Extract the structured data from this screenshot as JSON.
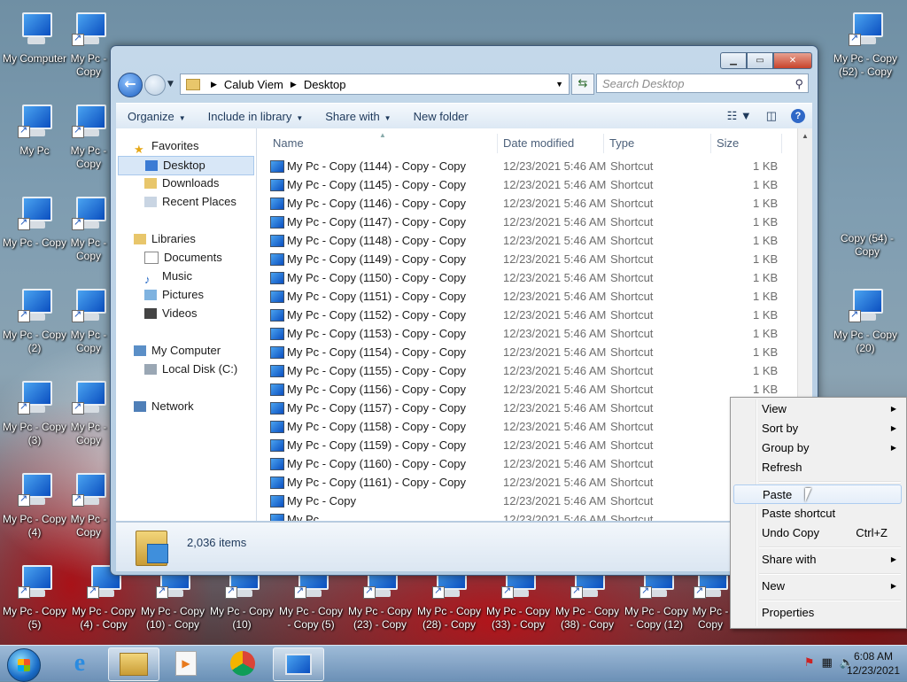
{
  "desktop": {
    "icons": [
      {
        "label": "My Computer"
      },
      {
        "label": "My Pc - Copy (6)"
      },
      {
        "label": "My Pc"
      },
      {
        "label": "My Pc - Copy (5) - C"
      },
      {
        "label": "My Pc - Copy"
      },
      {
        "label": "My Pc - Copy (7)"
      },
      {
        "label": "My Pc - Copy (2)"
      },
      {
        "label": "My Pc - Copy"
      },
      {
        "label": "My Pc - Copy (3)"
      },
      {
        "label": "My Pc - Copy (2) - C"
      },
      {
        "label": "My Pc - Copy (4)"
      },
      {
        "label": "My Pc - Copy (3) - C"
      },
      {
        "label": "My Pc - Copy (5)"
      },
      {
        "label": "My Pc - Copy (4) - Copy"
      },
      {
        "label": "My Pc - Copy (10) - Copy"
      },
      {
        "label": "My Pc - Copy (10)"
      },
      {
        "label": "My Pc - Copy - Copy (5)"
      },
      {
        "label": "My Pc - Copy (23) - Copy"
      },
      {
        "label": "My Pc - Copy (28) - Copy"
      },
      {
        "label": "My Pc - Copy (33) - Copy"
      },
      {
        "label": "My Pc - Copy (38) - Copy"
      },
      {
        "label": "My Pc - Copy - Copy (12)"
      },
      {
        "label": "My Pc - Copy (44) - Copy"
      },
      {
        "label": "My Pc - Copy (52) - Copy"
      },
      {
        "label": "Copy (54) - Copy"
      },
      {
        "label": "My Pc - Copy (20)"
      }
    ]
  },
  "explorer": {
    "address": {
      "segments": [
        "Calub Viem",
        "Desktop"
      ]
    },
    "search": {
      "placeholder": "Search Desktop"
    },
    "toolbar": {
      "organize": "Organize",
      "include": "Include in library",
      "share": "Share with",
      "new_folder": "New folder"
    },
    "nav": {
      "favorites": "Favorites",
      "desktop": "Desktop",
      "downloads": "Downloads",
      "recent": "Recent Places",
      "libraries": "Libraries",
      "documents": "Documents",
      "music": "Music",
      "pictures": "Pictures",
      "videos": "Videos",
      "computer": "My Computer",
      "local_disk": "Local Disk (C:)",
      "network": "Network"
    },
    "columns": {
      "name": "Name",
      "date": "Date modified",
      "type": "Type",
      "size": "Size"
    },
    "files": [
      {
        "name": "My Pc - Copy (1144) - Copy - Copy",
        "date": "12/23/2021 5:46 AM",
        "type": "Shortcut",
        "size": "1 KB"
      },
      {
        "name": "My Pc - Copy (1145) - Copy - Copy",
        "date": "12/23/2021 5:46 AM",
        "type": "Shortcut",
        "size": "1 KB"
      },
      {
        "name": "My Pc - Copy (1146) - Copy - Copy",
        "date": "12/23/2021 5:46 AM",
        "type": "Shortcut",
        "size": "1 KB"
      },
      {
        "name": "My Pc - Copy (1147) - Copy - Copy",
        "date": "12/23/2021 5:46 AM",
        "type": "Shortcut",
        "size": "1 KB"
      },
      {
        "name": "My Pc - Copy (1148) - Copy - Copy",
        "date": "12/23/2021 5:46 AM",
        "type": "Shortcut",
        "size": "1 KB"
      },
      {
        "name": "My Pc - Copy (1149) - Copy - Copy",
        "date": "12/23/2021 5:46 AM",
        "type": "Shortcut",
        "size": "1 KB"
      },
      {
        "name": "My Pc - Copy (1150) - Copy - Copy",
        "date": "12/23/2021 5:46 AM",
        "type": "Shortcut",
        "size": "1 KB"
      },
      {
        "name": "My Pc - Copy (1151) - Copy - Copy",
        "date": "12/23/2021 5:46 AM",
        "type": "Shortcut",
        "size": "1 KB"
      },
      {
        "name": "My Pc - Copy (1152) - Copy - Copy",
        "date": "12/23/2021 5:46 AM",
        "type": "Shortcut",
        "size": "1 KB"
      },
      {
        "name": "My Pc - Copy (1153) - Copy - Copy",
        "date": "12/23/2021 5:46 AM",
        "type": "Shortcut",
        "size": "1 KB"
      },
      {
        "name": "My Pc - Copy (1154) - Copy - Copy",
        "date": "12/23/2021 5:46 AM",
        "type": "Shortcut",
        "size": "1 KB"
      },
      {
        "name": "My Pc - Copy (1155) - Copy - Copy",
        "date": "12/23/2021 5:46 AM",
        "type": "Shortcut",
        "size": "1 KB"
      },
      {
        "name": "My Pc - Copy (1156) - Copy - Copy",
        "date": "12/23/2021 5:46 AM",
        "type": "Shortcut",
        "size": "1 KB"
      },
      {
        "name": "My Pc - Copy (1157) - Copy - Copy",
        "date": "12/23/2021 5:46 AM",
        "type": "Shortcut",
        "size": ""
      },
      {
        "name": "My Pc - Copy (1158) - Copy - Copy",
        "date": "12/23/2021 5:46 AM",
        "type": "Shortcut",
        "size": ""
      },
      {
        "name": "My Pc - Copy (1159) - Copy - Copy",
        "date": "12/23/2021 5:46 AM",
        "type": "Shortcut",
        "size": ""
      },
      {
        "name": "My Pc - Copy (1160) - Copy - Copy",
        "date": "12/23/2021 5:46 AM",
        "type": "Shortcut",
        "size": ""
      },
      {
        "name": "My Pc - Copy (1161) - Copy - Copy",
        "date": "12/23/2021 5:46 AM",
        "type": "Shortcut",
        "size": ""
      },
      {
        "name": "My Pc - Copy",
        "date": "12/23/2021 5:46 AM",
        "type": "Shortcut",
        "size": ""
      },
      {
        "name": "My Pc",
        "date": "12/23/2021 5:46 AM",
        "type": "Shortcut",
        "size": ""
      }
    ],
    "details": {
      "count": "2,036 items"
    }
  },
  "context_menu": {
    "view": "View",
    "sort_by": "Sort by",
    "group_by": "Group by",
    "refresh": "Refresh",
    "paste": "Paste",
    "paste_shortcut": "Paste shortcut",
    "undo_copy": "Undo Copy",
    "undo_shortcut": "Ctrl+Z",
    "share_with": "Share with",
    "new": "New",
    "properties": "Properties"
  },
  "taskbar": {
    "time": "6:08 AM",
    "date": "12/23/2021"
  }
}
